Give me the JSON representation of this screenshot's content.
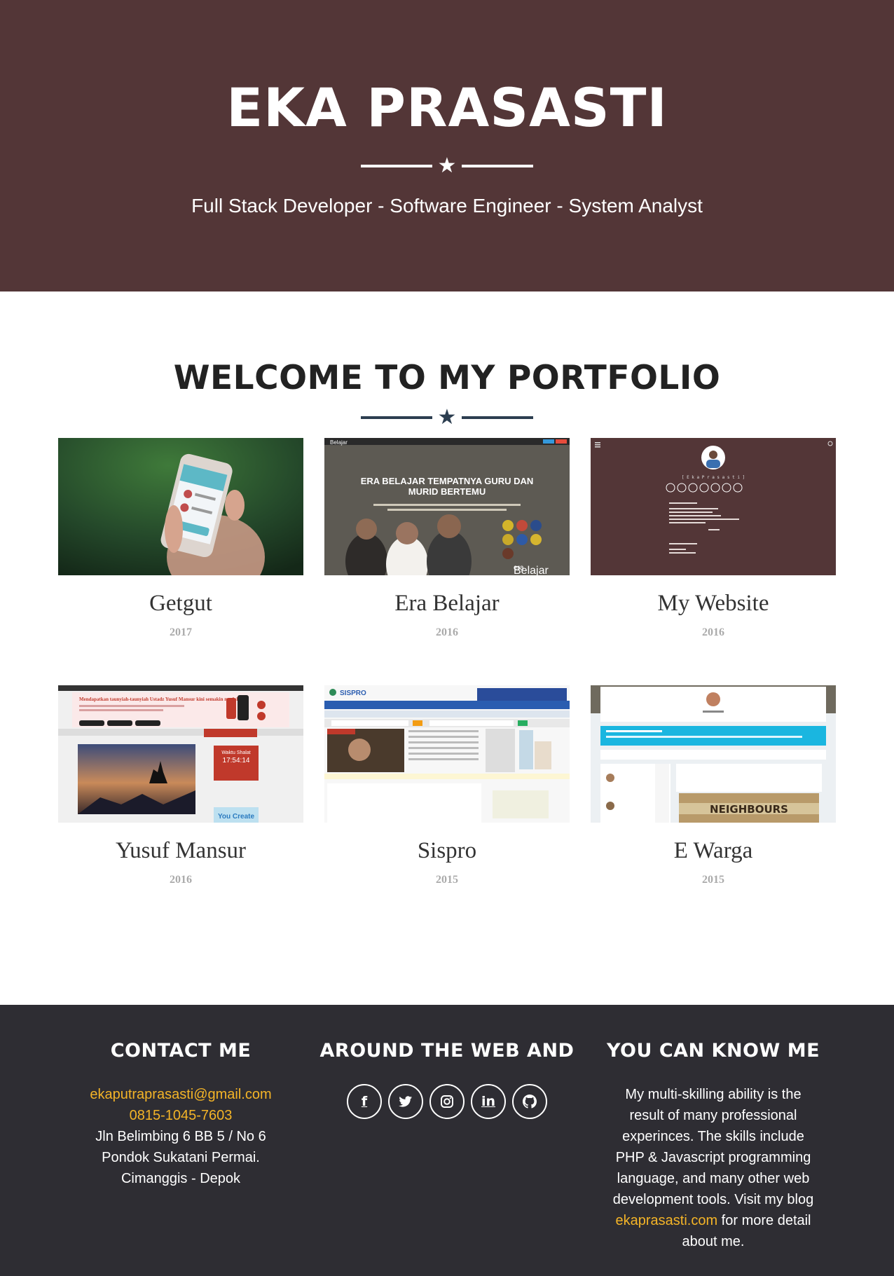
{
  "header": {
    "name": "EKA PRASASTI",
    "skills": "Full Stack Developer - Software Engineer - System Analyst"
  },
  "portfolio": {
    "title": "WELCOME TO MY PORTFOLIO",
    "items": [
      {
        "name": "Getgut",
        "year": "2017"
      },
      {
        "name": "Era Belajar",
        "year": "2016",
        "thumb_text": [
          "ERA BELAJAR TEMPATNYA GURU DAN",
          "MURID BERTEMU"
        ],
        "logo_small": "era",
        "logo_big": "Belajar"
      },
      {
        "name": "My Website",
        "year": "2016",
        "thumb_text": [
          "[ E k a   P r a s a s t i ]"
        ]
      },
      {
        "name": "Yusuf Mansur",
        "year": "2016",
        "thumb_text": [
          "Mendapatkan taunyiah-taunyiah Ustadz Yusuf Mansur kini semakin mudah",
          "Waktu Shalat",
          "17:54:14",
          "You Create"
        ]
      },
      {
        "name": "Sispro",
        "year": "2015",
        "thumb_text": [
          "SISPRO"
        ]
      },
      {
        "name": "E Warga",
        "year": "2015",
        "thumb_text": [
          "NEIGHBOURS"
        ]
      }
    ]
  },
  "footer": {
    "contact": {
      "title": "CONTACT ME",
      "email": "ekaputraprasasti@gmail.com",
      "phone": "0815-1045-7603",
      "address": "Jln Belimbing 6 BB 5 / No 6 Pondok Sukatani Permai. Cimanggis - Depok"
    },
    "web": {
      "title": "AROUND THE WEB AND",
      "socials": [
        {
          "icon": "facebook-icon",
          "glyph": "f"
        },
        {
          "icon": "twitter-icon",
          "glyph": "🐦"
        },
        {
          "icon": "instagram-icon",
          "glyph": "◎"
        },
        {
          "icon": "linkedin-icon",
          "glyph": "in"
        },
        {
          "icon": "github-icon",
          "glyph": "⌘"
        }
      ]
    },
    "about": {
      "title": "YOU CAN KNOW ME",
      "text_before": "My multi-skilling ability is the result of many professional experinces. The skills include PHP & Javascript programming language, and many other web development tools. Visit my blog",
      "link": "ekaprasasti.com",
      "text_after": "for more detail about me."
    }
  },
  "colors": {
    "header_bg": "#533637",
    "footer_bg": "#2e2d33",
    "accent": "#f4b427"
  }
}
